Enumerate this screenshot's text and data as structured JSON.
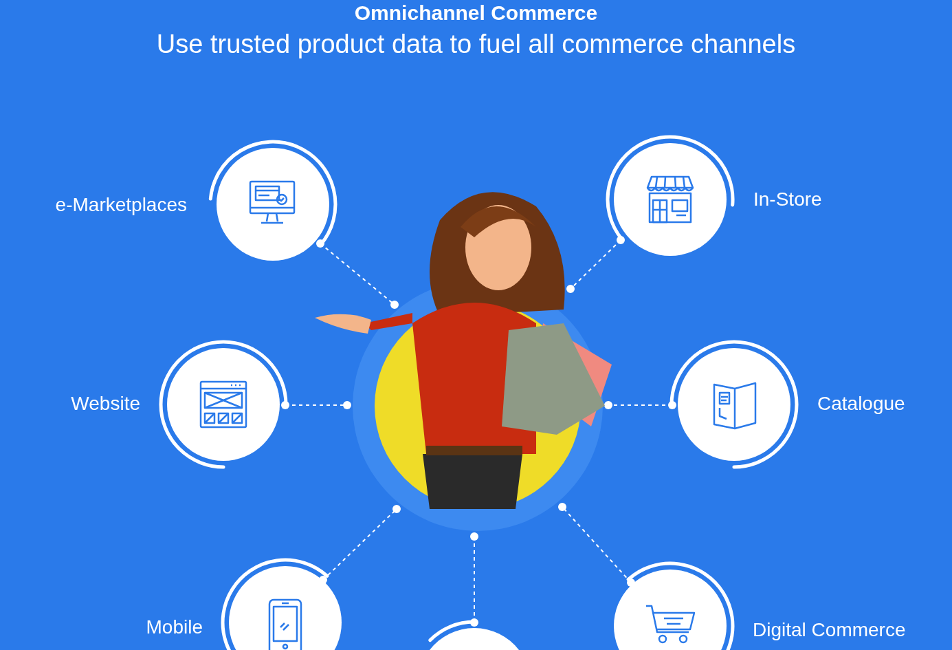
{
  "heading": {
    "title": "Omnichannel Commerce",
    "subtitle": "Use trusted product data to fuel all commerce channels"
  },
  "channels": [
    {
      "label": "e-Marketplaces",
      "kind": "monitor"
    },
    {
      "label": "In-Store",
      "kind": "store"
    },
    {
      "label": "Website",
      "kind": "website"
    },
    {
      "label": "Catalogue",
      "kind": "catalogue"
    },
    {
      "label": "Mobile",
      "kind": "mobile"
    },
    {
      "kind": "partial"
    },
    {
      "label": "Digital Commerce",
      "kind": "cart"
    }
  ]
}
